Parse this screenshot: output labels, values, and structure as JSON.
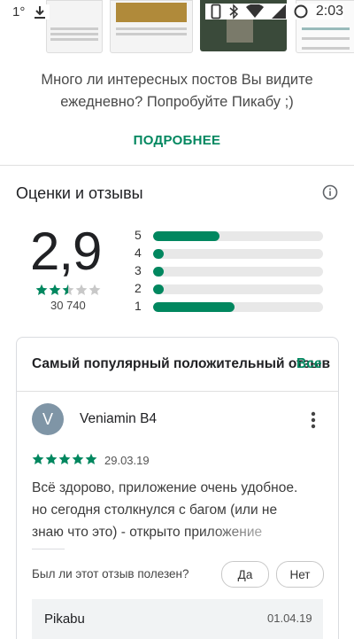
{
  "status_bar": {
    "left_indicator": "1°",
    "time": "2:03",
    "icons": [
      "download-icon",
      "phone-vibrate-icon",
      "bluetooth-icon",
      "wifi-icon",
      "signal-icon",
      "battery-icon"
    ]
  },
  "promo": {
    "line1": "Много ли интересных постов Вы видите",
    "line2": "ежедневно? Попробуйте Пикабу ;)",
    "more_label": "ПОДРОБНЕЕ"
  },
  "ratings": {
    "title": "Оценки и отзывы",
    "average": "2,9",
    "count": "30 740",
    "stars_value": 2.5,
    "bars": [
      {
        "label": "5",
        "fraction": 0.39
      },
      {
        "label": "4",
        "fraction": 0.06
      },
      {
        "label": "3",
        "fraction": 0.06
      },
      {
        "label": "2",
        "fraction": 0.06
      },
      {
        "label": "1",
        "fraction": 0.48
      }
    ]
  },
  "review_card": {
    "title": "Самый популярный положительный отзыв",
    "all_label": "Все",
    "avatar_letter": "V",
    "author": "Veniamin B4",
    "stars": 5,
    "date": "29.03.19",
    "text_line1": "Всё здорово, приложение очень удобное.",
    "text_line2": "но сегодня столкнулся с багом (или не",
    "text_line3": "знаю что это) - открыто приложение",
    "helpful_question": "Был ли этот отзыв полезен?",
    "yes_label": "Да",
    "no_label": "Нет",
    "reply_name": "Pikabu",
    "reply_date": "01.04.19"
  },
  "colors": {
    "accent": "#01875f",
    "bar_track": "#e8e8e8",
    "star_empty": "#c8c8c8",
    "avatar_bg": "#7f95a6"
  }
}
